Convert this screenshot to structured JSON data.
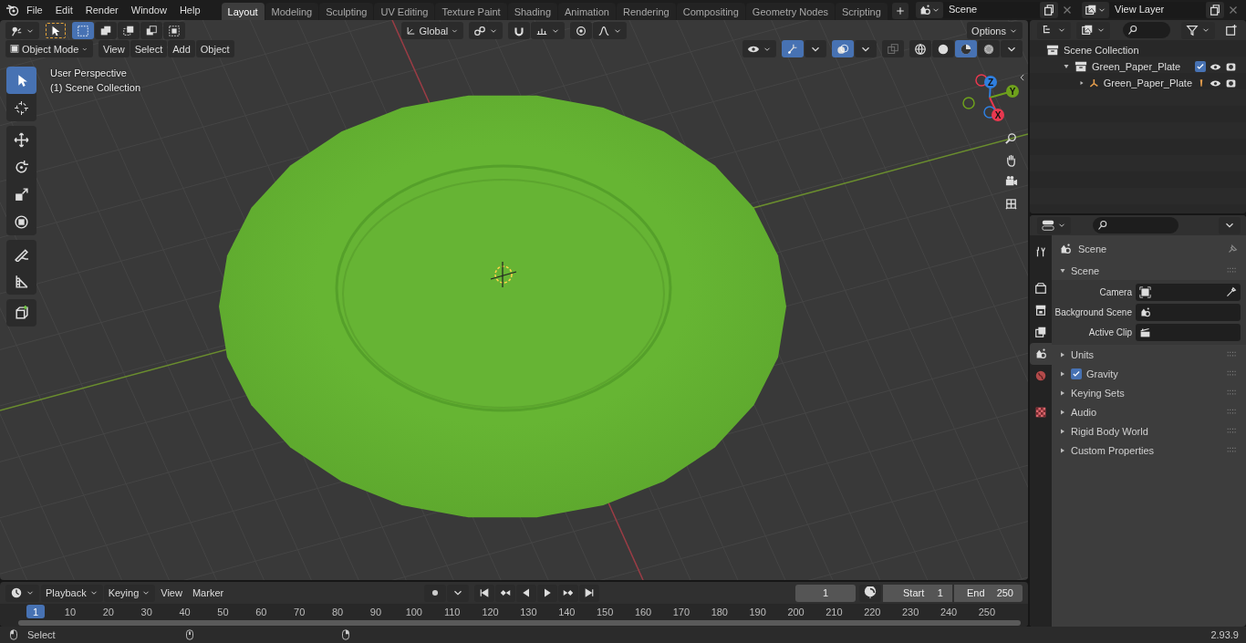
{
  "top_bar": {
    "menus": [
      "File",
      "Edit",
      "Render",
      "Window",
      "Help"
    ],
    "workspace_tabs": [
      {
        "label": "Layout",
        "selected": true
      },
      {
        "label": "Modeling",
        "selected": false
      },
      {
        "label": "Sculpting",
        "selected": false
      },
      {
        "label": "UV Editing",
        "selected": false
      },
      {
        "label": "Texture Paint",
        "selected": false
      },
      {
        "label": "Shading",
        "selected": false
      },
      {
        "label": "Animation",
        "selected": false
      },
      {
        "label": "Rendering",
        "selected": false
      },
      {
        "label": "Compositing",
        "selected": false
      },
      {
        "label": "Geometry Nodes",
        "selected": false
      },
      {
        "label": "Scripting",
        "selected": false
      }
    ],
    "scene": {
      "value": "Scene"
    },
    "view_layer": {
      "value": "View Layer"
    }
  },
  "viewport": {
    "tool_header": {
      "select_modes": [
        {
          "selected": true
        },
        {
          "selected": false
        },
        {
          "selected": false
        },
        {
          "selected": false
        },
        {
          "selected": false
        }
      ],
      "orientation": "Global",
      "options": "Options"
    },
    "header": {
      "mode": "Object Mode",
      "menus": [
        "View",
        "Select",
        "Add",
        "Object"
      ],
      "shading_modes": [
        {
          "selected": false
        },
        {
          "selected": false
        },
        {
          "selected": true
        },
        {
          "selected": false
        }
      ]
    },
    "info": [
      "User Perspective",
      "(1) Scene Collection"
    ],
    "tools": [
      {
        "selected": true
      },
      {
        "selected": false
      },
      {
        "selected": false
      },
      {
        "selected": false
      },
      {
        "selected": false
      },
      {
        "selected": false
      },
      {
        "selected": false
      },
      {
        "selected": false
      },
      {
        "selected": false
      }
    ],
    "axes": [
      {
        "label": "Z",
        "color": "#2f7fe0"
      },
      {
        "label": "Y",
        "color": "#6ea11c"
      },
      {
        "label": "X",
        "color": "#e8384f"
      }
    ]
  },
  "outliner": {
    "root": {
      "label": "Scene Collection",
      "children": [
        {
          "label": "Green_Paper_Plate",
          "expanded": true,
          "checked": true,
          "children": [
            {
              "label": "Green_Paper_Plate",
              "expanded": false
            }
          ]
        }
      ]
    }
  },
  "properties": {
    "tabs": [
      {
        "selected": false
      },
      {
        "selected": false
      },
      {
        "selected": false
      },
      {
        "selected": false
      },
      {
        "selected": true
      },
      {
        "selected": false
      },
      {
        "selected": false
      }
    ],
    "context": "Scene",
    "panel": {
      "title": "Scene",
      "expanded": true,
      "fields": [
        {
          "label": "Camera"
        },
        {
          "label": "Background Scene"
        },
        {
          "label": "Active Clip"
        }
      ]
    },
    "subpanels": [
      {
        "title": "Units",
        "kind": "plain",
        "expanded": false
      },
      {
        "title": "Gravity",
        "kind": "checkbox",
        "checked": true,
        "expanded": false
      },
      {
        "title": "Keying Sets",
        "kind": "plain",
        "expanded": false
      },
      {
        "title": "Audio",
        "kind": "plain",
        "expanded": false
      },
      {
        "title": "Rigid Body World",
        "kind": "plain",
        "expanded": false
      },
      {
        "title": "Custom Properties",
        "kind": "plain",
        "expanded": false
      }
    ]
  },
  "timeline": {
    "menus": [
      {
        "label": "Playback",
        "dropdown": true
      },
      {
        "label": "Keying",
        "dropdown": true
      },
      {
        "label": "View",
        "dropdown": false
      },
      {
        "label": "Marker",
        "dropdown": false
      }
    ],
    "current_frame": "1",
    "start": {
      "label": "Start",
      "value": "1"
    },
    "end": {
      "label": "End",
      "value": "250"
    },
    "playhead": "1",
    "ruler": [
      "10",
      "20",
      "30",
      "40",
      "50",
      "60",
      "70",
      "80",
      "90",
      "100",
      "110",
      "120",
      "130",
      "140",
      "150",
      "160",
      "170",
      "180",
      "190",
      "200",
      "210",
      "220",
      "230",
      "240",
      "250"
    ]
  },
  "status_bar": {
    "hint": "Select",
    "version": "2.93.9"
  }
}
